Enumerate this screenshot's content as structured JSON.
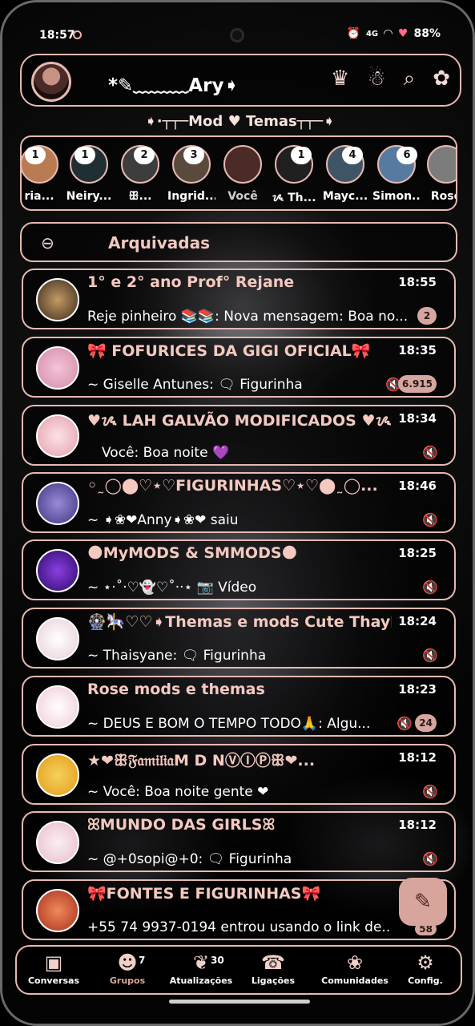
{
  "status": {
    "time": "18:57",
    "signal": "4G",
    "battery": "88%",
    "icons": [
      "alarm-icon",
      "signal-icon",
      "wifi-icon",
      "heart-icon"
    ]
  },
  "header": {
    "title": "*✎﹏﹏﹏Ary➧",
    "icons": [
      "crown-icon",
      "ghost-icon",
      "search-icon",
      "camera-icon"
    ]
  },
  "subtitle": "➧·┬┬─Mod ♥ Temas┬┬─➧",
  "stories": [
    {
      "name": "ria...",
      "count": "1"
    },
    {
      "name": "Neiry...",
      "count": "1"
    },
    {
      "name": "ꕥ...",
      "count": "2"
    },
    {
      "name": "Ingrid...",
      "count": "3"
    },
    {
      "name": "Você",
      "count": ""
    },
    {
      "name": "ᝰ Th...",
      "count": "1"
    },
    {
      "name": "Mayc...",
      "count": "4"
    },
    {
      "name": "Simon...",
      "count": "6"
    },
    {
      "name": "Rose",
      "count": ""
    }
  ],
  "archived": {
    "label": "Arquivadas"
  },
  "chats": [
    {
      "name": "1° e 2° ano Prof° Rejane",
      "time": "18:55",
      "message": "Reje pinheiro 📚📚: Nova mensagem: Boa no...",
      "badge": "2",
      "avatar_color": "#6d5a4a"
    },
    {
      "name": "🎀 FOFURICES DA GIGI OFICIAL🎀",
      "time": "18:35",
      "message": "~ Giselle Antunes: 🗨 Figurinha",
      "badge": "6.915",
      "avatar_color": "#e9c6d6"
    },
    {
      "name": "♥ᝰ LAH GALVÃO MODIFICADOS ♥ᝰ",
      "time": "18:34",
      "message": "Você: Boa noite 💜",
      "badge": "",
      "avatar_color": "#f2c7cd"
    },
    {
      "name": "◦˷◯⬤♡⋆♡FIGURINHAS♡⋆♡⬤˷◯...",
      "time": "18:46",
      "message": "~ ➧❀❤Anny➧❀❤ saiu",
      "badge": "",
      "avatar_color": "#7a6fb8"
    },
    {
      "name": "🌑MyMODS & SMMODS🌑",
      "time": "18:25",
      "message": "~ ⋆·˚‧♡👻♡˚‧·⋆ 📷 Vídeo",
      "badge": "",
      "avatar_color": "#5b1fa8"
    },
    {
      "name": "🎡🎠♡♡➧Themas e mods Cute Thayl...",
      "time": "18:24",
      "message": "~ Thaisyane: 🗨 Figurinha",
      "badge": "",
      "avatar_color": "#f7f2f4"
    },
    {
      "name": "Rose mods e themas",
      "time": "18:23",
      "message": "~ DEUS E BOM O TEMPO TODO🙏: Algu...",
      "badge": "24",
      "avatar_color": "#f6e3ea"
    },
    {
      "name": "★❤ꕥ𝔉𝔞𝔪𝔦𝔩𝔦𝔞M D NⓋⒾⓅꕥ❤...",
      "time": "18:12",
      "message": "~ Você: Boa noite gente ❤",
      "badge": "",
      "avatar_color": "#f1c21d"
    },
    {
      "name": "ꕤMUNDO DAS GIRLSꕤ",
      "time": "18:12",
      "message": "~ @+0sopi@+0: 🗨 Figurinha",
      "badge": "",
      "avatar_color": "#f3dfe6"
    },
    {
      "name": "🎀FONTES E FIGURINHAS🎀",
      "time": "",
      "message": "+55 74 9937-0194 entrou usando o link de...",
      "badge": "58",
      "avatar_color": "#d9452c"
    }
  ],
  "nav": [
    {
      "label": "Conversas",
      "icon": "chats-icon",
      "count": ""
    },
    {
      "label": "Grupos",
      "icon": "groups-icon",
      "count": "7"
    },
    {
      "label": "Atualizações",
      "icon": "updates-icon",
      "count": "30"
    },
    {
      "label": "Ligações",
      "icon": "calls-icon",
      "count": ""
    },
    {
      "label": "Comunidades",
      "icon": "communities-icon",
      "count": ""
    },
    {
      "label": "Config.",
      "icon": "settings-icon",
      "count": ""
    }
  ]
}
